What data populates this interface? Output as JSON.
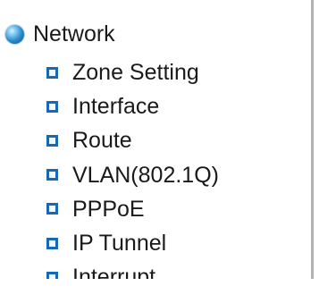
{
  "section": {
    "label": "Network",
    "icon": "globe-icon"
  },
  "menu": {
    "bullet_icon": "square-bullet-icon",
    "bullet_color": "#1769b8",
    "items": [
      {
        "label": "Zone Setting"
      },
      {
        "label": "Interface"
      },
      {
        "label": "Route"
      },
      {
        "label": "VLAN(802.1Q)"
      },
      {
        "label": "PPPoE"
      },
      {
        "label": "IP Tunnel"
      },
      {
        "label": "Interrupt"
      }
    ]
  }
}
